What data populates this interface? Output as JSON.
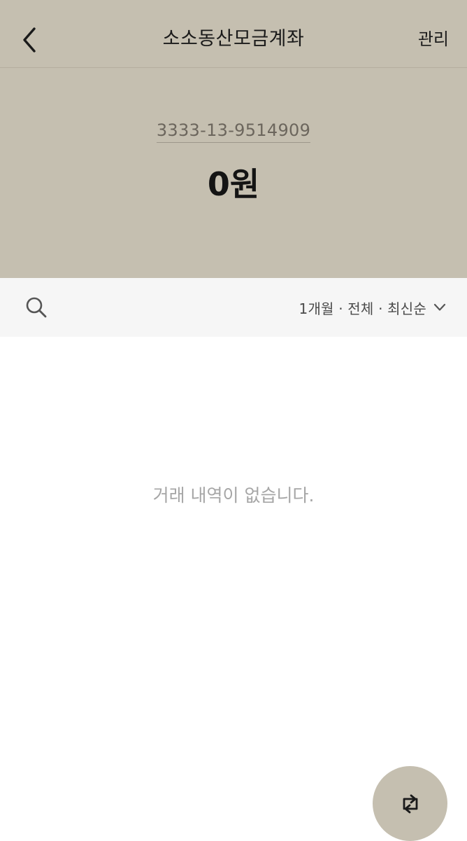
{
  "header": {
    "title": "소소동산모금계좌",
    "manage_label": "관리",
    "account_number": "3333-13-9514909",
    "balance": "0원"
  },
  "filter": {
    "summary": "1개월 · 전체 · 최신순"
  },
  "transactions": {
    "empty_message": "거래 내역이 없습니다."
  },
  "icons": {
    "back": "back-arrow-icon",
    "search": "search-icon",
    "dropdown": "chevron-down-icon",
    "transfer": "transfer-arrows-icon"
  },
  "colors": {
    "header_bg": "#c5bfb0",
    "filter_bg": "#f6f6f6",
    "fab_bg": "#c5bfb0"
  }
}
